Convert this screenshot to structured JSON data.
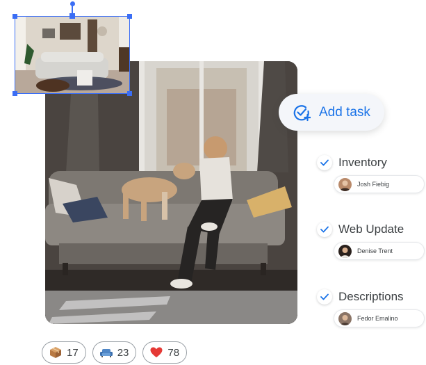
{
  "add_task": {
    "label": "Add task",
    "icon": "add-task-icon"
  },
  "tasks": [
    {
      "title": "Inventory",
      "assignee": "Josh Fiebig",
      "done": true
    },
    {
      "title": "Web Update",
      "assignee": "Denise Trent",
      "done": true
    },
    {
      "title": "Descriptions",
      "assignee": "Fedor Emalino",
      "done": true
    }
  ],
  "reactions": [
    {
      "icon": "package-icon",
      "count": "17"
    },
    {
      "icon": "sofa-icon",
      "count": "23"
    },
    {
      "icon": "heart-icon",
      "count": "78"
    }
  ],
  "colors": {
    "accent": "#1a73e8",
    "selection": "#3b6ef5",
    "heart": "#e53935"
  }
}
